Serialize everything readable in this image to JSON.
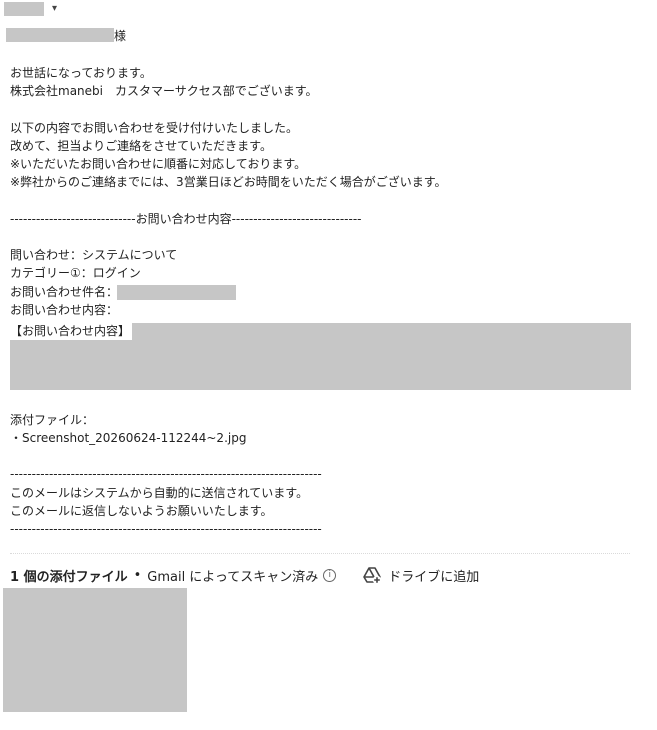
{
  "header": {
    "caret_glyph": "▾",
    "honorific": "様"
  },
  "message": {
    "greeting_lines": [
      "お世話になっております。",
      "株式会社manebi　カスタマーサクセス部でございます。"
    ],
    "intro_lines": [
      "以下の内容でお問い合わせを受け付けいたしました。",
      "改めて、担当よりご連絡をさせていただきます。",
      "※いただいたお問い合わせに順番に対応しております。",
      "※弊社からのご連絡までには、3営業日ほどお時間をいただく場合がございます。"
    ],
    "section_header": "-----------------------------お問い合わせ内容------------------------------",
    "fields": [
      "問い合わせ：システムについて",
      "カテゴリー①：ログイン",
      "お問い合わせ件名：",
      "お問い合わせ内容："
    ],
    "content_label": "【お問い合わせ内容】",
    "attachment_label": "添付ファイル：",
    "attachment_item": "・Screenshot_20260624-112244~2.jpg",
    "footer_rule": "------------------------------------------------------------------------",
    "footer_lines": [
      "このメールはシステムから自動的に送信されています。",
      "このメールに返信しないようお願いいたします。"
    ]
  },
  "attachments_bar": {
    "count_label": "1 個の添付ファイル",
    "separator": "•",
    "scan_label": "Gmail によってスキャン済み",
    "info_glyph": "i",
    "drive_label": "ドライブに追加"
  }
}
